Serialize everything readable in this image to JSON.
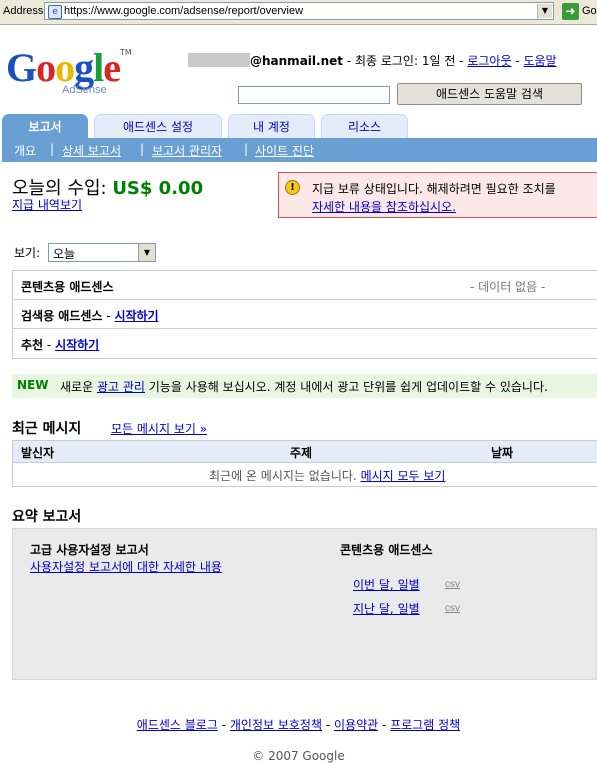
{
  "browser": {
    "address_label": "Address",
    "url": "https://www.google.com/adsense/report/overview",
    "go_label": "Go"
  },
  "logo": {
    "text_g": "G",
    "text_o1": "o",
    "text_o2": "o",
    "text_g2": "g",
    "text_l": "l",
    "text_e": "e",
    "sub": "AdSense",
    "tm": "TM"
  },
  "account": {
    "email": "@hanmail.net",
    "last_login": " - 최종 로그인: 1일 전 - ",
    "logout": "로그아웃",
    "sep": " - ",
    "help": "도움말"
  },
  "help_search": {
    "button": "애드센스 도움말 검색",
    "value": ""
  },
  "tabs": [
    {
      "label": "보고서"
    },
    {
      "label": "애드센스 설정"
    },
    {
      "label": "내 계정"
    },
    {
      "label": "리소스"
    }
  ],
  "subnav": {
    "items": [
      "개요",
      "상세 보고서",
      "보고서 관리자",
      "사이트 진단"
    ],
    "sep": "|"
  },
  "earnings": {
    "label": "오늘의 수입: ",
    "value": "US$ 0.00",
    "payment_history": "지급 내역보기"
  },
  "alert": {
    "text": "지급 보류 상태입니다. 해제하려면 필요한 조치를",
    "link": "자세한 내용을 참조하십시오."
  },
  "view": {
    "label": "보기:",
    "selected": "오늘"
  },
  "products": [
    {
      "name": "콘텐츠용 애드센스",
      "status": "- 데이터 없음 -"
    },
    {
      "name": "검색용 애드센스",
      "dash": " - ",
      "link": "시작하기"
    },
    {
      "name": "추천",
      "dash": " - ",
      "link": "시작하기"
    }
  ],
  "new_banner": {
    "badge": "NEW",
    "before": "새로운 ",
    "link": "광고 관리",
    "after": " 기능을 사용해 보십시오. 계정 내에서 광고 단위를 쉽게 업데이트할 수 있습니다."
  },
  "messages": {
    "title": "최근 메시지",
    "view_all": "모든 메시지 보기 »",
    "columns": [
      "발신자",
      "주제",
      "날짜"
    ],
    "empty_text": "최근에 온 메시지는 없습니다. ",
    "empty_link": "메시지 모두 보기"
  },
  "summary": {
    "title": "요약 보고서",
    "advanced_title": "고급 사용자설정 보고서",
    "advanced_link": "사용자설정 보고서에 대한 자세한 내용",
    "content_title": "콘텐츠용 애드센스",
    "this_month": "이번 달, 일별",
    "last_month": "지난 달, 일별",
    "csv": "csv"
  },
  "footer": {
    "links": [
      "애드센스 블로그",
      "개인정보 보호정책",
      "이용약관",
      "프로그램 정책"
    ],
    "sep": " - ",
    "copyright": "© 2007 Google"
  }
}
